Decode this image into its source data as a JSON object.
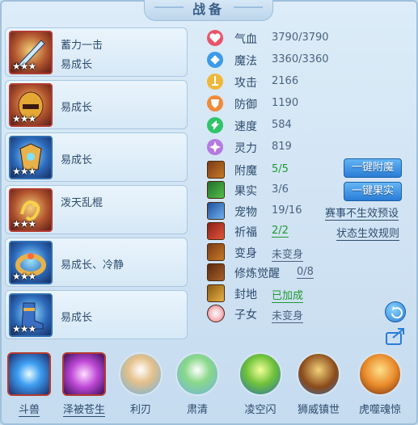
{
  "title": "战备",
  "equipment": [
    {
      "name": "蓄力一击",
      "trait": "易成长",
      "stars": "★★★"
    },
    {
      "name": "",
      "trait": "易成长",
      "stars": "★★★"
    },
    {
      "name": "",
      "trait": "易成长",
      "stars": "★★★"
    },
    {
      "name": "泼天乱棍",
      "trait": "",
      "stars": "★★★"
    },
    {
      "name": "",
      "trait": "易成长、冷静",
      "stars": "★★★"
    },
    {
      "name": "",
      "trait": "易成长",
      "stars": "★★★"
    }
  ],
  "stats": [
    {
      "label": "气血",
      "value": "3790/3790",
      "icon": "heart-icon",
      "color": "#e8556a"
    },
    {
      "label": "魔法",
      "value": "3360/3360",
      "icon": "diamond-icon",
      "color": "#3d9be8"
    },
    {
      "label": "攻击",
      "value": "2166",
      "icon": "sword-icon",
      "color": "#f0b83a"
    },
    {
      "label": "防御",
      "value": "1190",
      "icon": "shield-icon",
      "color": "#f08a3a"
    },
    {
      "label": "速度",
      "value": "584",
      "icon": "speed-icon",
      "color": "#2fc46a"
    },
    {
      "label": "灵力",
      "value": "819",
      "icon": "spirit-icon",
      "color": "#b47ae0"
    }
  ],
  "attributes": {
    "fumo": {
      "label": "附魔",
      "value": "5/5"
    },
    "guoshi": {
      "label": "果实",
      "value": "3/6"
    },
    "baowu": {
      "label": "宠物",
      "value": "19/16"
    },
    "qifu": {
      "label": "祈福",
      "value": "2/2"
    },
    "bianshen": {
      "label": "变身",
      "value": "未变身"
    },
    "xiulian": {
      "label": "修炼觉醒",
      "value": "0/8"
    },
    "fengdi": {
      "label": "封地",
      "value": "已加成"
    },
    "zinv": {
      "label": "子女",
      "value": "未变身"
    }
  },
  "buttons": {
    "one_click_enchant": "一键附魔",
    "one_click_fruit": "一键果实",
    "event_preset": "赛事不生效预设",
    "status_rules": "状态生效规则"
  },
  "skills": [
    {
      "label": "斗兽"
    },
    {
      "label": "泽被苍生"
    },
    {
      "label": "利刃"
    },
    {
      "label": "肃清"
    },
    {
      "label": "凌空闪"
    },
    {
      "label": "狮威镇世"
    },
    {
      "label": "虎噬魂惊"
    }
  ],
  "colors": {
    "accent": "#2a7cd6",
    "green": "#1f9a2f",
    "text": "#2d4c6e"
  }
}
